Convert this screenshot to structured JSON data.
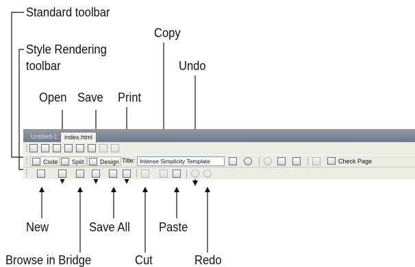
{
  "callouts": {
    "standard_toolbar": "Standard toolbar",
    "style_rendering_line1": "Style Rendering",
    "style_rendering_line2": "toolbar",
    "copy": "Copy",
    "undo": "Undo",
    "open": "Open",
    "save": "Save",
    "print": "Print",
    "new": "New",
    "save_all": "Save All",
    "paste": "Paste",
    "browse_in_bridge": "Browse in Bridge",
    "cut": "Cut",
    "redo": "Redo"
  },
  "tabs": [
    {
      "label": "Untitled-1"
    },
    {
      "label": "index.html"
    }
  ],
  "document_toolbar": {
    "code_label": "Code",
    "split_label": "Split",
    "design_label": "Design",
    "title_label": "Title:",
    "title_value": "Intense Simplicity Template",
    "check_page_label": "Check Page"
  },
  "colors": {
    "tabstrip": "#7a8696",
    "toolbar_bg": "#ecebe4",
    "leader_line": "#111111"
  }
}
